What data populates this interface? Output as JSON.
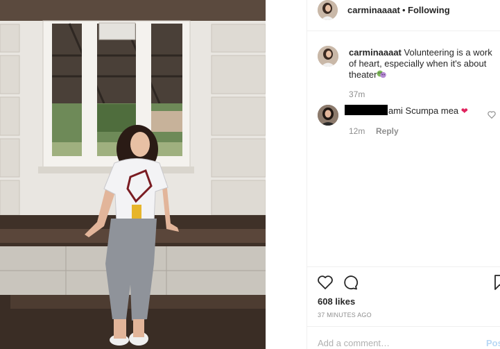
{
  "post": {
    "photo_alt": "",
    "header": {
      "username": "carminaaaat",
      "separator": "•",
      "follow_status": "Following"
    },
    "caption": {
      "username": "carminaaaat",
      "text": "Volunteering is a work of heart, especially when it's about theater",
      "emoji": "theater-masks-icon",
      "time": "37m"
    },
    "comments": [
      {
        "username_redacted": true,
        "text": "ami Scumpa mea",
        "emoji": "❤",
        "time": "12m",
        "reply_label": "Reply"
      }
    ],
    "actions": {
      "likes": "608 likes",
      "time_ago": "37 MINUTES AGO"
    },
    "add_comment": {
      "placeholder": "Add a comment…",
      "post_label": "Post"
    }
  },
  "colors": {
    "text": "#262626",
    "muted": "#8e8e8e",
    "heart": "#e0245e",
    "post_disabled": "#b8d8f5",
    "border": "#efefef"
  }
}
